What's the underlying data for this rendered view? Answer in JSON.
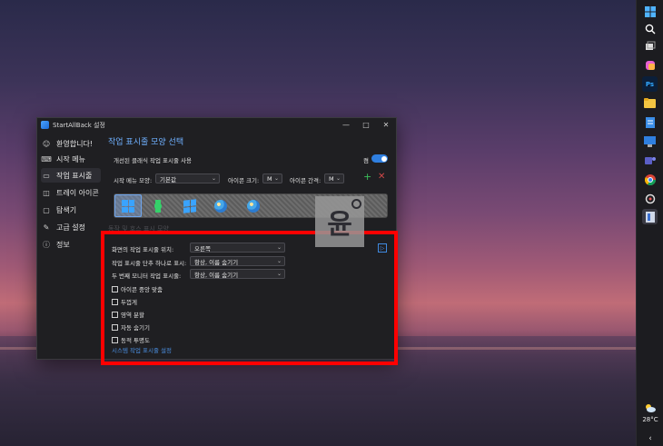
{
  "window": {
    "title": "StartAllBack 설정",
    "controls": {
      "minimize": "—",
      "maximize": "□",
      "close": "✕"
    }
  },
  "sidebar": {
    "items": [
      {
        "icon": "☺",
        "label": "환영합니다!"
      },
      {
        "icon": "⌨",
        "label": "시작 메뉴"
      },
      {
        "icon": "▭",
        "label": "작업 표시줄"
      },
      {
        "icon": "◫",
        "label": "트레이 아이콘"
      },
      {
        "icon": "▢",
        "label": "탐색기"
      },
      {
        "icon": "✎",
        "label": "고급 설정"
      },
      {
        "icon": "ⓘ",
        "label": "정보"
      }
    ]
  },
  "main": {
    "title": "작업 표시줄 모양 선택",
    "classic_label": "개선된 클래식 작업 표시줄 사용",
    "toggle_label": "켬",
    "start_menu_style_label": "시작 메뉴 모양:",
    "start_menu_style_value": "기본값",
    "icon_size_label": "아이콘 크기:",
    "icon_size_value": "M",
    "icon_spacing_label": "아이콘 간격:",
    "icon_spacing_value": "M",
    "plus": "+",
    "remove": "✕",
    "behind_text": "동작 및 호스 표시 모양",
    "badge": "▷",
    "position_label": "화면의 작업 표시줄 위치:",
    "position_value": "오른쪽",
    "combine_label": "작업 표시줄 단추 하나로 표시:",
    "combine_value": "항상, 이름 숨기기",
    "second_monitor_label": "두 번째 모니터 작업 표시줄:",
    "second_monitor_value": "항상, 이름 숨기기",
    "checkboxes": [
      "아이콘 중앙 맞춤",
      "두껍게",
      "영역 분할",
      "자동 숨기기",
      "동적 투명도"
    ],
    "system_link": "시스템 작업 표시줄 설정"
  },
  "watermark": {
    "text": "윤"
  },
  "taskbar": {
    "temperature": "28°C",
    "chevron": "‹"
  },
  "colors": {
    "accent": "#6fb0ff",
    "highlight": "#ff0000",
    "toggle": "#2f7fe0"
  }
}
